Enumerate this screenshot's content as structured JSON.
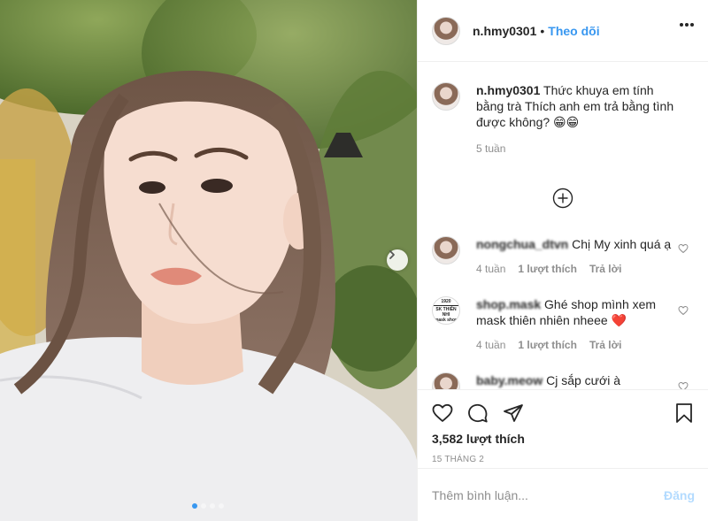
{
  "header": {
    "username": "n.hmy0301",
    "separator": "•",
    "follow_label": "Theo dõi",
    "more_icon": "more-horizontal-icon"
  },
  "caption": {
    "username": "n.hmy0301",
    "text": "Thức khuya em tính bằng trà Thích anh em trả bằng tình được không? 😁😁",
    "time": "5 tuần"
  },
  "load_more_icon": "plus-circle-icon",
  "comments": [
    {
      "username": "nongchua_dtvn",
      "text": "Chị My xinh quá ạ",
      "time": "4 tuần",
      "likes": "1 lượt thích",
      "reply": "Trả lời"
    },
    {
      "username": "shop.mask",
      "avatar_lines": [
        "1920",
        "SK THIÊN NHI",
        "mask shop"
      ],
      "text": "Ghé shop mình xem mask thiên nhiên nheee ❤️",
      "time": "4 tuần",
      "likes": "1 lượt thích",
      "reply": "Trả lời"
    },
    {
      "username": "baby.meow",
      "text": "Cj sắp cưới à"
    }
  ],
  "actions": {
    "icons": [
      "heart-icon",
      "comment-icon",
      "share-icon",
      "bookmark-icon"
    ],
    "likes": "3,582 lượt thích",
    "date": "15 THÁNG 2"
  },
  "add_comment": {
    "placeholder": "Thêm bình luận...",
    "post_label": "Đăng"
  },
  "carousel": {
    "total": 4,
    "active": 1
  },
  "colors": {
    "link": "#3897f0",
    "muted": "#8e8e8e",
    "post_disabled": "#b3dbff",
    "heart_emoji": "#ed4956"
  }
}
